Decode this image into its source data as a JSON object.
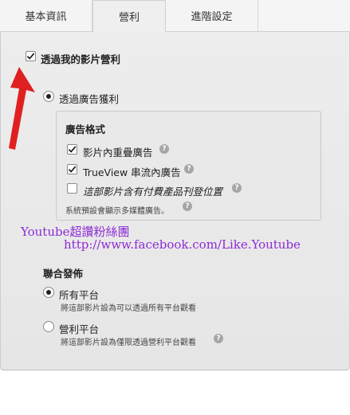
{
  "tabs": [
    {
      "label": "基本資訊",
      "active": false
    },
    {
      "label": "營利",
      "active": true
    },
    {
      "label": "進階設定",
      "active": false
    }
  ],
  "monetize": {
    "label": "透過我的影片營利",
    "checked": true
  },
  "ads": {
    "radio_label": "透過廣告獲利",
    "selected": true,
    "format_title": "廣告格式",
    "options": [
      {
        "label": "影片內重疊廣告",
        "checked": true
      },
      {
        "label": "TrueView 串流內廣告",
        "checked": true
      },
      {
        "label": "這部影片含有付費產品刊登位置",
        "checked": false
      }
    ],
    "note": "系統預設會顯示多媒體廣告。"
  },
  "watermark": {
    "line1": "Youtube超讚粉絲團",
    "line2": "http://www.facebook.com/Like.Youtube"
  },
  "syndication": {
    "title": "聯合發佈",
    "options": [
      {
        "label": "所有平台",
        "desc": "將這部影片設為可以透過所有平台觀看",
        "selected": true
      },
      {
        "label": "營利平台",
        "desc": "將這部影片設為僅限透過營利平台觀看",
        "selected": false
      }
    ]
  },
  "colors": {
    "arrow": "#e02020",
    "watermark": "#8d2bd6",
    "panel": "#ececec"
  },
  "icons": {
    "checkbox_mark": "check-icon",
    "help": "question-icon",
    "annotation": "red-arrow-icon"
  }
}
